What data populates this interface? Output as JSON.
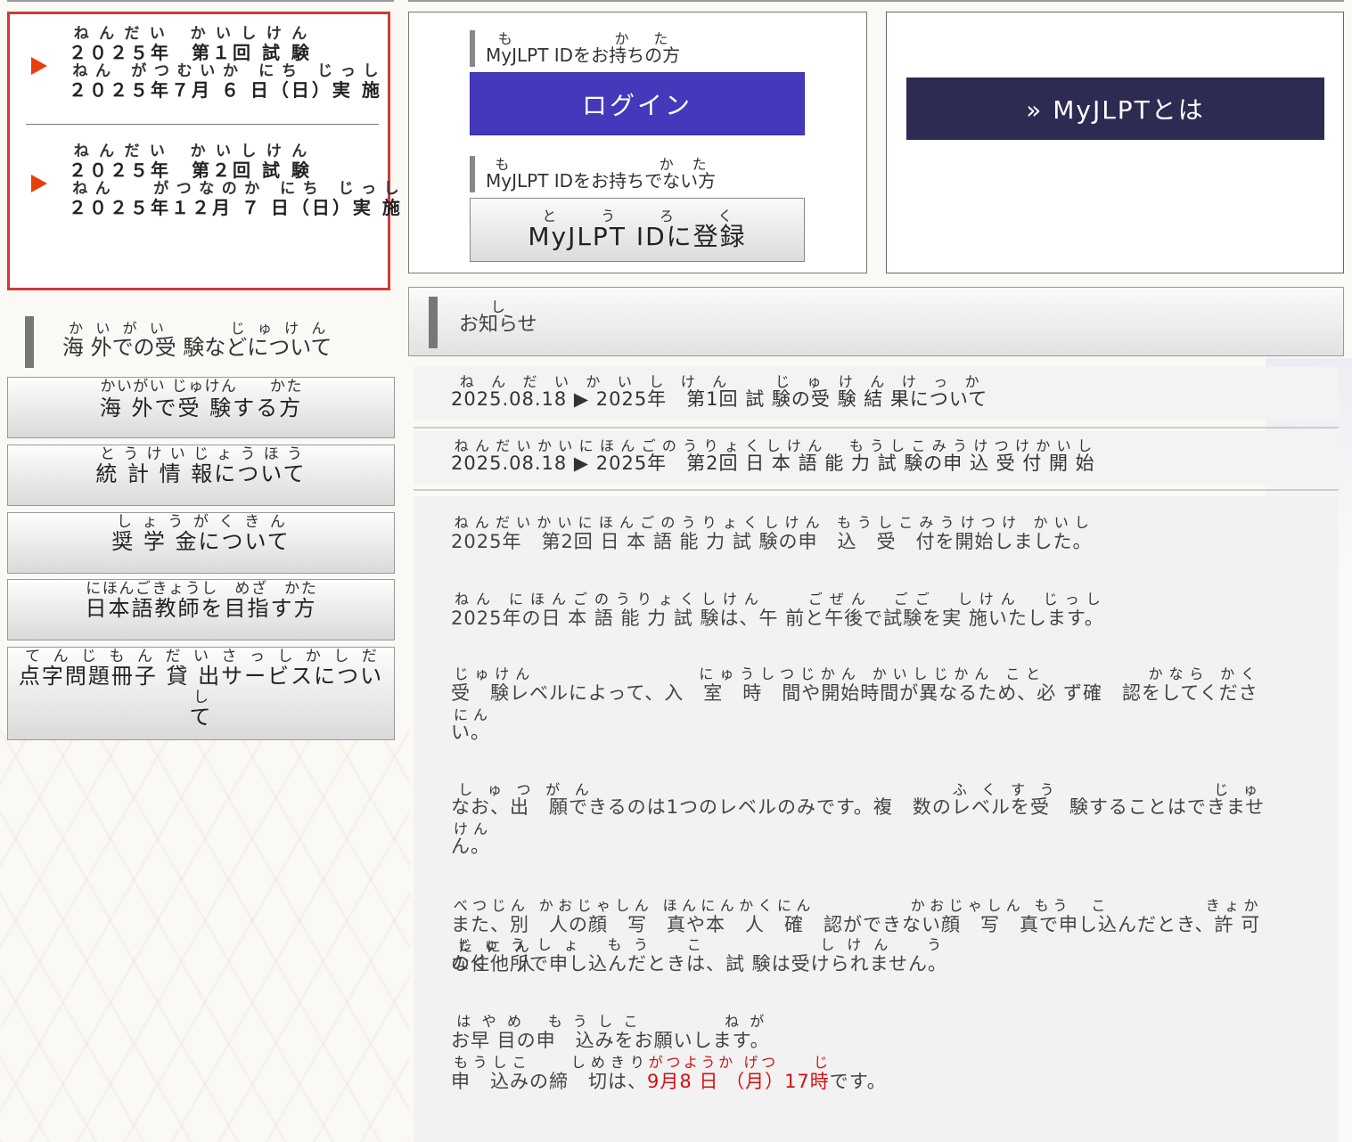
{
  "exams": [
    {
      "line1": {
        "label": "２０２５年　第１回 試 験",
        "ruby": "ねんだい かいしけん"
      },
      "line2": {
        "label": "２０２５年７月 ６ 日（日）実 施",
        "ruby": "ねん がつむいか にち じっし"
      }
    },
    {
      "line1": {
        "label": "２０２５年　第２回 試 験",
        "ruby": "ねんだい かいしけん"
      },
      "line2": {
        "label": "２０２５年１２月 ７ 日（日）実 施",
        "ruby": "ねん　 がつなのか にち じっし"
      }
    }
  ],
  "login": {
    "have_id_label": "MyJLPT IDをお持ちの方",
    "have_id_ruby": "も　　かた",
    "login_button": "ログイン",
    "no_id_label": "MyJLPT IDをお持ちでない方",
    "no_id_ruby": "も　　　　かた",
    "register_button": "MyJLPT IDに登録",
    "register_ruby": "とうろく"
  },
  "about": {
    "button": "» MyJLPTとは"
  },
  "overseas": {
    "heading": "海 外での受 験などについて",
    "heading_ruby": "かいがい　　じゅけん"
  },
  "side_menu": [
    {
      "label": "海 外で受 験する方",
      "ruby": "かいがい じゅけん　　かた"
    },
    {
      "label": "統 計 情 報について",
      "ruby": "とうけいじょうほう"
    },
    {
      "label": "奨 学 金について",
      "ruby": "しょうがくきん"
    },
    {
      "label": "日本語教師を目指す方",
      "ruby": "にほんごきょうし　めざ　かた"
    },
    {
      "label": "点字問題冊子 貸 出サービスについて",
      "ruby": "てんじもんだいさっしかしだし"
    }
  ],
  "notices": {
    "header": "お知らせ",
    "header_ruby": "し",
    "items": [
      {
        "text": "2025.08.18 ▶ 2025年　第1回 試 験の受 験 結 果について",
        "ruby": "ねんだいかいしけん　じゅけんけっか"
      },
      {
        "text": "2025.08.18 ▶ 2025年　第2回 日 本 語 能 力 試 験の申 込 受 付 開 始",
        "ruby": "ねんだいかいにほんごのうりょくしけん　もうしこみうけつけかいし"
      }
    ]
  },
  "detail": {
    "p1": {
      "text": "2025年　第2回 日 本 語 能 力 試 験の申　込　受　付を開始しました。",
      "ruby": "ねんだいかいにほんごのうりょくしけん もうしこみうけつけ かいし"
    },
    "p2": {
      "text": "2025年の日 本 語 能 力 試 験は、午 前と午後で試験を実 施いたします。",
      "ruby": "ねん にほんごのうりょくしけん　　ごぜん　ごご　しけん　じっし"
    },
    "p3": {
      "text": "受　験レベルによって、入　室　時　間や開始時間が異なるため、必 ず確　認をしてください。",
      "ruby": "じゅけん　　　　　　　　にゅうしつじかん かいしじかん こと　　　　　かなら かくにん"
    },
    "p4": {
      "text": "なお、出　願できるのは1つのレベルのみです。複　数のレベルを受　験することはできません。",
      "ruby": "しゅつがん　　　　　　　　　　　　ふくすう　　　　　じゅけん"
    },
    "p5a": {
      "text": "また、別　人の顔　写　真や本　人　確　認ができない顔　写　真で申し込んだとき、許 可なく他 人",
      "ruby": "べつじん かおじゃしん ほんにんかくにん　　　　　かおじゃしん もう　こ　　　　　きょか　　たにん"
    },
    "p5b": {
      "text": "の住　所で申し込んだときは、試 験は受けられません。",
      "ruby": "じゅうしょ もう　こ　　　　しけん　う"
    },
    "p6": {
      "text": "お早 目の申　込みをお願いします。",
      "ruby": "はやめ もうしこ　　　ねが"
    },
    "p7_prefix": "申　込みの締　切は、",
    "p7_prefix_ruby": "もうしこ　　しめきり",
    "p7_date": "9月8 日 （月）17時",
    "p7_date_ruby": "がつようか げつ　　じ",
    "p7_suffix": "です。"
  }
}
